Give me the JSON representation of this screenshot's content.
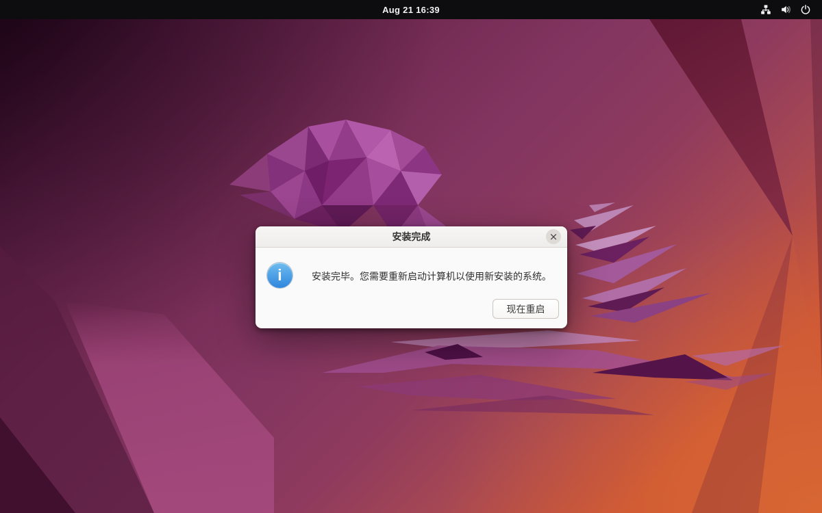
{
  "topbar": {
    "clock": "Aug 21 16:39",
    "icons": [
      {
        "name": "network-wired-icon"
      },
      {
        "name": "volume-icon"
      },
      {
        "name": "power-icon"
      }
    ]
  },
  "dialog": {
    "title": "安装完成",
    "close_glyph": "×",
    "info_glyph": "i",
    "message": "安装完毕。您需要重新启动计算机以使用新安装的系统。",
    "restart_button": "现在重启"
  },
  "colors": {
    "topbar_bg": "#0d0d0f",
    "titlebar_bg": "#f5f4f2",
    "dialog_bg": "#fbfafa",
    "info_blue": "#3689e6",
    "wallpaper_dark_plum": "#31082a",
    "wallpaper_magenta": "#8c3055",
    "wallpaper_orange": "#c8553a",
    "jellyfish_purple": "#9a4790"
  }
}
